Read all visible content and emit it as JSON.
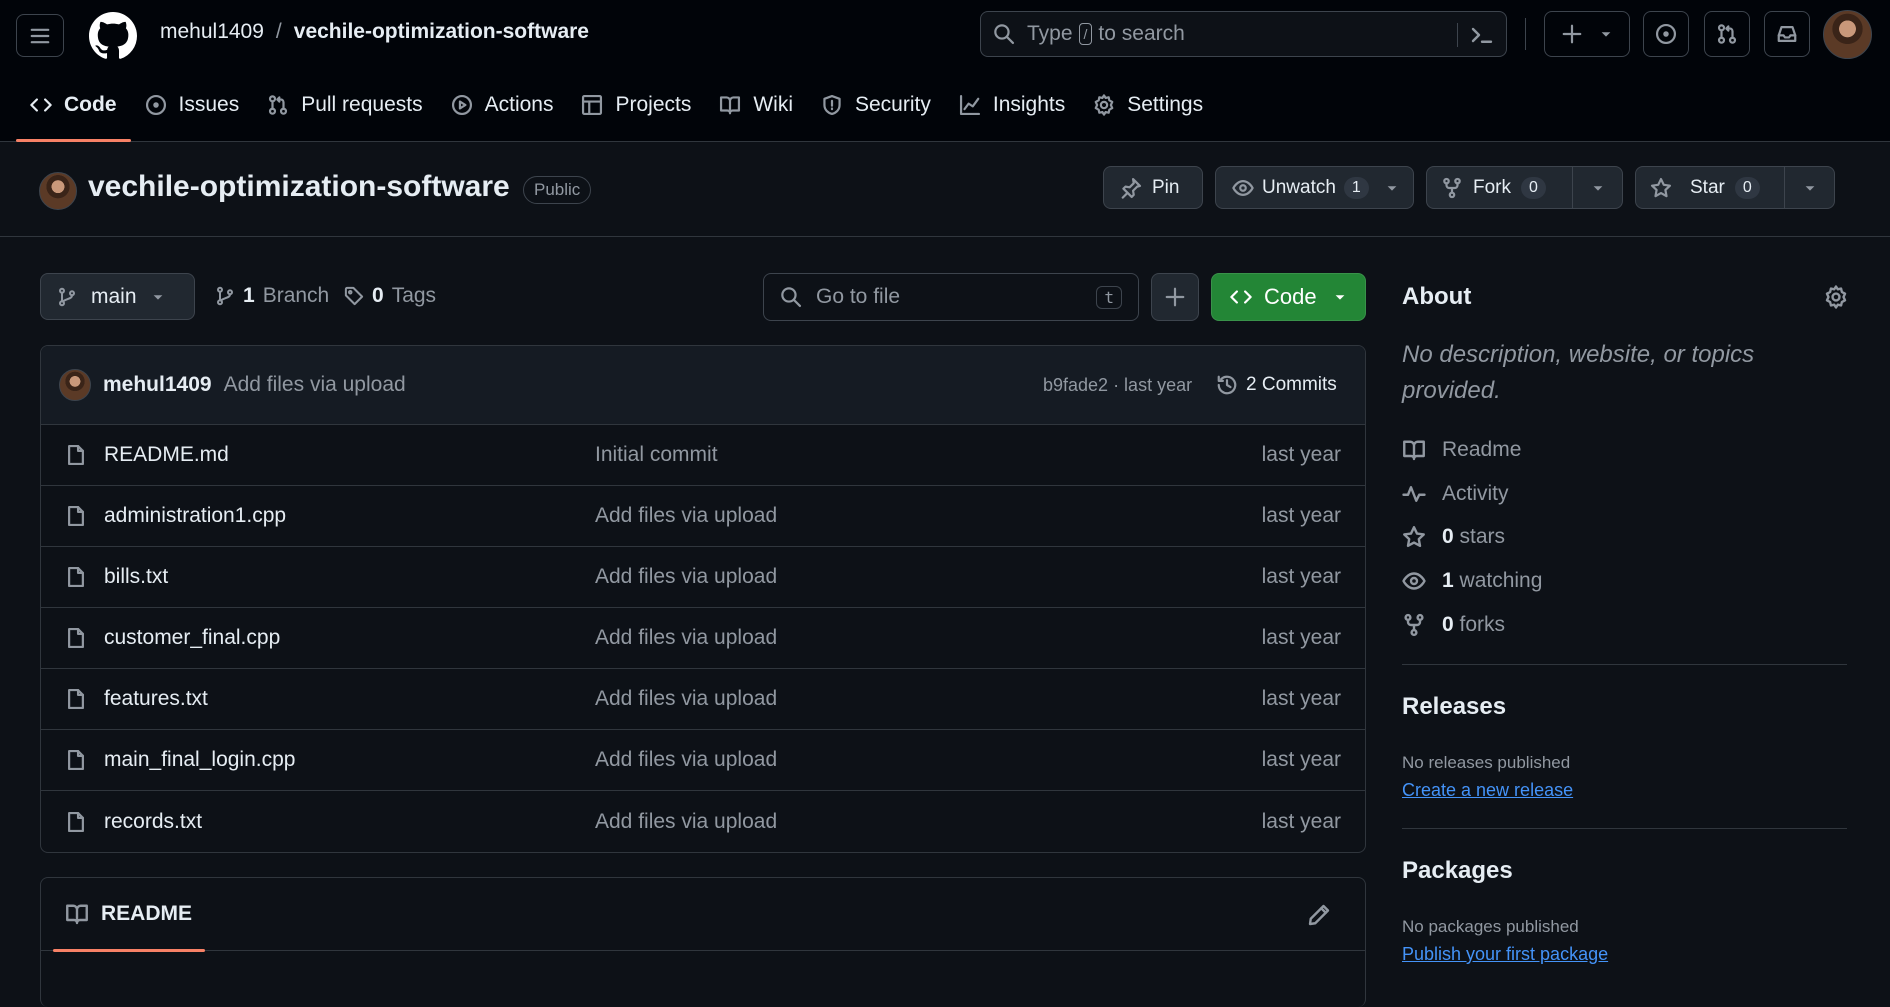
{
  "header": {
    "owner": "mehul1409",
    "separator": "/",
    "repo": "vechile-optimization-software",
    "search": {
      "prefix": "Type",
      "key": "/",
      "suffix": "to search"
    }
  },
  "nav_tabs": [
    {
      "label": "Code",
      "icon": "code-icon",
      "active": true
    },
    {
      "label": "Issues",
      "icon": "issue-icon"
    },
    {
      "label": "Pull requests",
      "icon": "pull-request-icon"
    },
    {
      "label": "Actions",
      "icon": "play-icon"
    },
    {
      "label": "Projects",
      "icon": "table-icon"
    },
    {
      "label": "Wiki",
      "icon": "book-icon"
    },
    {
      "label": "Security",
      "icon": "shield-icon"
    },
    {
      "label": "Insights",
      "icon": "graph-icon"
    },
    {
      "label": "Settings",
      "icon": "gear-icon"
    }
  ],
  "repo_head": {
    "title": "vechile-optimization-software",
    "visibility": "Public",
    "pin_label": "Pin",
    "watch_label": "Unwatch",
    "watch_count": "1",
    "fork_label": "Fork",
    "fork_count": "0",
    "star_label": "Star",
    "star_count": "0"
  },
  "toolbar": {
    "branch": "main",
    "branch_count": "1",
    "branch_label": "Branch",
    "tag_count": "0",
    "tag_label": "Tags",
    "goto_placeholder": "Go to file",
    "goto_key": "t",
    "code_label": "Code"
  },
  "commit": {
    "user": "mehul1409",
    "message": "Add files via upload",
    "hash_time": "b9fade2 · last year",
    "count_label": "2 Commits"
  },
  "files": [
    {
      "name": "README.md",
      "message": "Initial commit",
      "time": "last year"
    },
    {
      "name": "administration1.cpp",
      "message": "Add files via upload",
      "time": "last year"
    },
    {
      "name": "bills.txt",
      "message": "Add files via upload",
      "time": "last year"
    },
    {
      "name": "customer_final.cpp",
      "message": "Add files via upload",
      "time": "last year"
    },
    {
      "name": "features.txt",
      "message": "Add files via upload",
      "time": "last year"
    },
    {
      "name": "main_final_login.cpp",
      "message": "Add files via upload",
      "time": "last year"
    },
    {
      "name": "records.txt",
      "message": "Add files via upload",
      "time": "last year"
    }
  ],
  "readme": {
    "label": "README"
  },
  "sidebar": {
    "about_title": "About",
    "description": "No description, website, or topics provided.",
    "readme_label": "Readme",
    "activity_label": "Activity",
    "stars_count": "0",
    "stars_label": "stars",
    "watching_count": "1",
    "watching_label": "watching",
    "forks_count": "0",
    "forks_label": "forks",
    "releases_title": "Releases",
    "releases_note": "No releases published",
    "releases_link": "Create a new release",
    "packages_title": "Packages",
    "packages_note": "No packages published",
    "packages_link": "Publish your first package"
  },
  "colors": {
    "background": "#0d1117",
    "header_bg": "#010409",
    "accent_underline": "#f78166",
    "code_button": "#238636",
    "link": "#4493f8"
  }
}
